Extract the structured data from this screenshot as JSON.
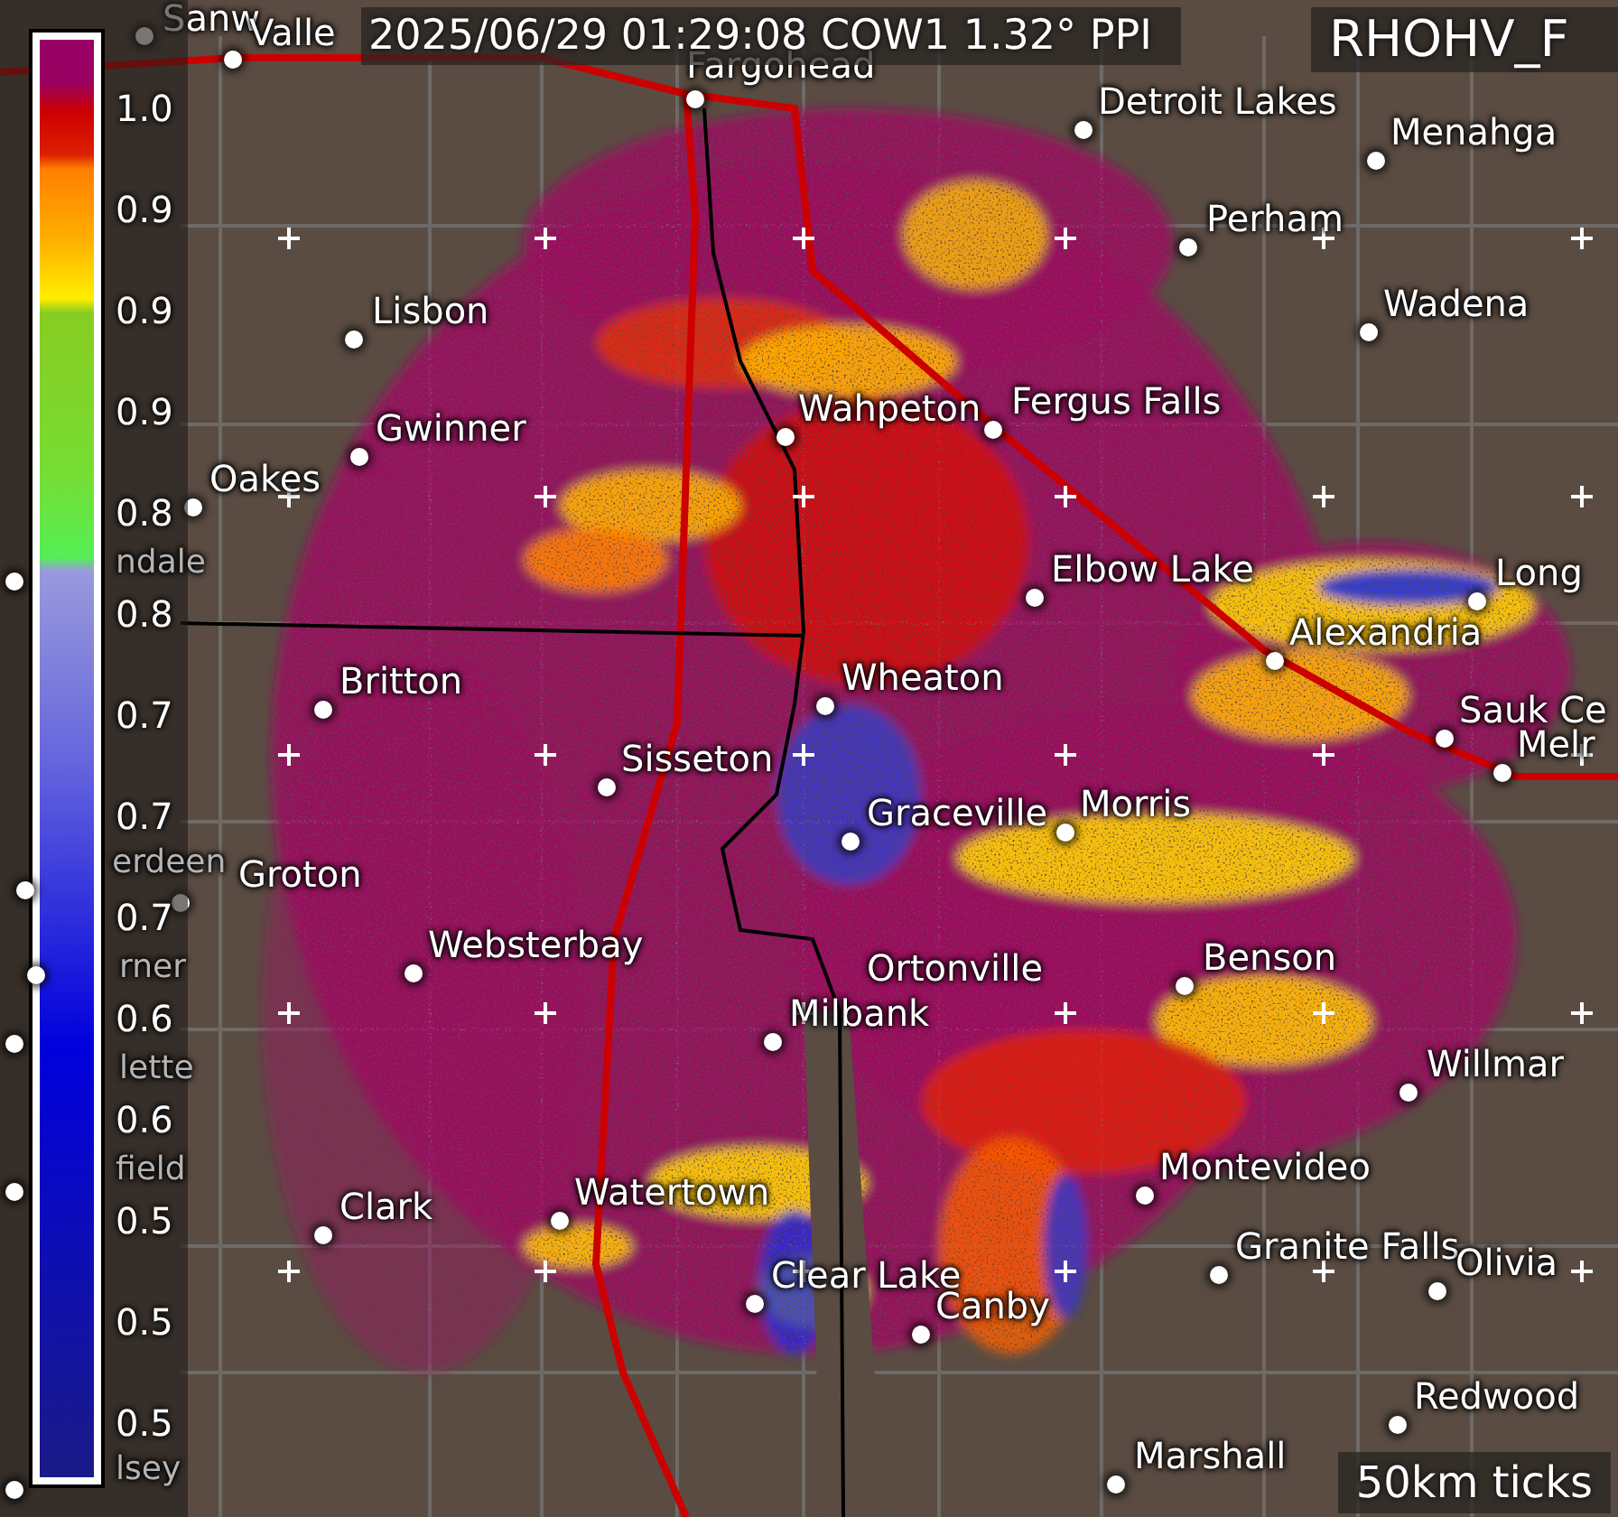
{
  "header": {
    "title": "2025/06/29 01:29:08 COW1 1.32° PPI",
    "product": "RHOHV_F"
  },
  "legend": {
    "labels": [
      "1.0",
      "0.9",
      "0.9",
      "0.9",
      "0.8",
      "0.8",
      "0.7",
      "0.7",
      "0.7",
      "0.6",
      "0.6",
      "0.5",
      "0.5",
      "0.5"
    ]
  },
  "places": [
    {
      "name": "Sanw",
      "hidden": false
    },
    {
      "name": "Valle",
      "hidden": false
    },
    {
      "name": "Fargohead",
      "hidden": false
    },
    {
      "name": "Detroit Lakes",
      "hidden": false
    },
    {
      "name": "Menahga",
      "hidden": false
    },
    {
      "name": "Perham",
      "hidden": false
    },
    {
      "name": "Wadena",
      "hidden": false
    },
    {
      "name": "Lisbon",
      "hidden": false
    },
    {
      "name": "Gwinner",
      "hidden": false
    },
    {
      "name": "Oakes",
      "hidden": false
    },
    {
      "name": "Wahpeton",
      "hidden": false
    },
    {
      "name": "Fergus Falls",
      "hidden": false
    },
    {
      "name": "Elbow Lake",
      "hidden": false
    },
    {
      "name": "Long",
      "hidden": false
    },
    {
      "name": "Alexandria",
      "hidden": false
    },
    {
      "name": "Sauk Ce",
      "hidden": false
    },
    {
      "name": "Melr",
      "hidden": false
    },
    {
      "name": "Britton",
      "hidden": false
    },
    {
      "name": "Wheaton",
      "hidden": false
    },
    {
      "name": "Sisseton",
      "hidden": false
    },
    {
      "name": "Graceville",
      "hidden": false
    },
    {
      "name": "Morris",
      "hidden": false
    },
    {
      "name": "Groton",
      "hidden": false
    },
    {
      "name": "Websterbay",
      "hidden": false
    },
    {
      "name": "Ortonville",
      "hidden": false
    },
    {
      "name": "Milbank",
      "hidden": false
    },
    {
      "name": "Benson",
      "hidden": false
    },
    {
      "name": "Willmar",
      "hidden": false
    },
    {
      "name": "Montevideo",
      "hidden": false
    },
    {
      "name": "Clark",
      "hidden": false
    },
    {
      "name": "Watertown",
      "hidden": false
    },
    {
      "name": "Granite Falls",
      "hidden": false
    },
    {
      "name": "Olivia",
      "hidden": false
    },
    {
      "name": "Clear Lake",
      "hidden": false
    },
    {
      "name": "Canby",
      "hidden": false
    },
    {
      "name": "Redwood",
      "hidden": false
    },
    {
      "name": "Marshall",
      "hidden": false
    },
    {
      "name": "ndale",
      "hidden": true
    },
    {
      "name": "erdeen",
      "hidden": true
    },
    {
      "name": "rner",
      "hidden": true
    },
    {
      "name": "lette",
      "hidden": true
    },
    {
      "name": "field",
      "hidden": true
    },
    {
      "name": "lsey",
      "hidden": true
    }
  ],
  "footer": {
    "scale_note": "50km ticks"
  }
}
